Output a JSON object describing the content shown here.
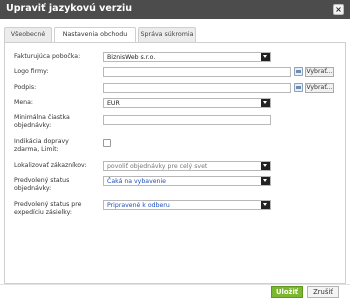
{
  "window": {
    "title": "Upraviť jazykovú verziu",
    "close_symbol": "×"
  },
  "tabs": [
    {
      "label": "Všeobecné",
      "active": false
    },
    {
      "label": "Nastavenia obchodu",
      "active": true
    },
    {
      "label": "Správa súkromia",
      "active": false
    }
  ],
  "form": {
    "branch": {
      "label": "Fakturujúca pobočka:",
      "value": "BiznisWeb s.r.o."
    },
    "logo": {
      "label": "Logo firmy:",
      "value": "",
      "browse_label": "Vybrať..."
    },
    "signature": {
      "label": "Podpis:",
      "value": "",
      "browse_label": "Vybrať..."
    },
    "currency": {
      "label": "Mena:",
      "value": "EUR"
    },
    "min_order": {
      "label": "Minimálna čiastka objednávky:",
      "value": ""
    },
    "free_shipping": {
      "label": "Indikácia dopravy zdarma, Limit:",
      "checked": false
    },
    "localize": {
      "label": "Lokalizovať zákazníkov:",
      "value": "povoliť objednávky pre celý svet"
    },
    "order_status": {
      "label": "Predvolený status objednávky:",
      "value": "Čaká na vybavenie"
    },
    "dispatch_status": {
      "label": "Predvolený status pre expedíciu zásielky:",
      "value": "Pripravené k odberu"
    }
  },
  "footer": {
    "save_label": "Uložiť",
    "cancel_label": "Zrušiť"
  },
  "colors": {
    "titlebar": "#4c4c4c",
    "save": "#7cb82f",
    "status_text": "#1f4fbf"
  }
}
